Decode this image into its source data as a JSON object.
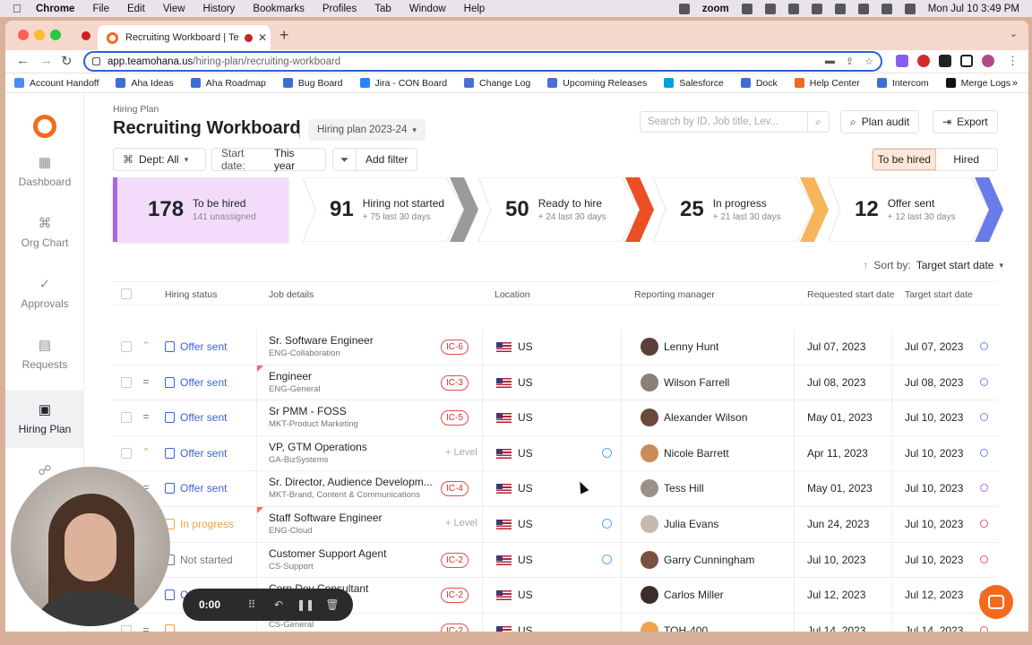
{
  "menubar": {
    "app": "Chrome",
    "items": [
      "File",
      "Edit",
      "View",
      "History",
      "Bookmarks",
      "Profiles",
      "Tab",
      "Window",
      "Help"
    ],
    "zoom": "zoom",
    "datetime": "Mon Jul 10  3:49 PM"
  },
  "browser": {
    "tab_title": "Recruiting Workboard | Te",
    "url_host": "app.teamohana.us",
    "url_path": "/hiring-plan/recruiting-workboard"
  },
  "bookmarks": [
    {
      "label": "Account Handoff",
      "color": "#4a8cf7"
    },
    {
      "label": "Aha Ideas",
      "color": "#3b6fd6"
    },
    {
      "label": "Aha Roadmap",
      "color": "#3b6fd6"
    },
    {
      "label": "Bug Board",
      "color": "#3b6fd6"
    },
    {
      "label": "Jira - CON Board",
      "color": "#2684ff"
    },
    {
      "label": "Change Log",
      "color": "#4a6fd6"
    },
    {
      "label": "Upcoming Releases",
      "color": "#4a6fd6"
    },
    {
      "label": "Salesforce",
      "color": "#00a1e0"
    },
    {
      "label": "Dock",
      "color": "#3b6fd6"
    },
    {
      "label": "Help Center",
      "color": "#f26b1d"
    },
    {
      "label": "Intercom",
      "color": "#3b6fd6"
    },
    {
      "label": "Merge Logs",
      "color": "#111111"
    }
  ],
  "sidebar": {
    "items": [
      {
        "label": "Dashboard",
        "icon": "grid-icon"
      },
      {
        "label": "Org Chart",
        "icon": "org-chart-icon"
      },
      {
        "label": "Approvals",
        "icon": "check-icon"
      },
      {
        "label": "Requests",
        "icon": "document-icon"
      },
      {
        "label": "Hiring Plan",
        "icon": "calendar-icon"
      },
      {
        "label": "He",
        "icon": "people-icon"
      }
    ]
  },
  "header": {
    "breadcrumb": "Hiring Plan",
    "title": "Recruiting Workboard",
    "plan": "Hiring plan 2023-24",
    "search_placeholder": "Search by ID, Job title, Lev...",
    "plan_audit": "Plan audit",
    "export": "Export"
  },
  "filters": {
    "dept": "Dept: All",
    "start_label": "Start date:",
    "start_value": "This year",
    "add_filter": "Add filter",
    "toggle_on": "To be hired",
    "toggle_off": "Hired"
  },
  "summary": [
    {
      "num": "178",
      "label": "To be hired",
      "sub": "141 unassigned",
      "color": "#a869e0"
    },
    {
      "num": "91",
      "label": "Hiring not started",
      "sub": "+ 75 last 30 days",
      "color": "#9a9a9a"
    },
    {
      "num": "50",
      "label": "Ready to hire",
      "sub": "+ 24 last 30 days",
      "color": "#ec4f23"
    },
    {
      "num": "25",
      "label": "In progress",
      "sub": "+ 21 last 30 days",
      "color": "#f7b55a"
    },
    {
      "num": "12",
      "label": "Offer sent",
      "sub": "+ 12 last 30 days",
      "color": "#6a7bea"
    }
  ],
  "sort": {
    "label": "Sort by:",
    "value": "Target start date"
  },
  "table": {
    "headers": [
      "Hiring status",
      "Job details",
      "Location",
      "Reporting manager",
      "Requested start date",
      "Target start date"
    ],
    "rows": [
      {
        "prio": "⌃",
        "status": "Offer sent",
        "status_color": "#3b63d6",
        "title": "Sr. Software Engineer",
        "dept": "ENG-Collaboration",
        "level": "IC-6",
        "loc": "US",
        "globe": false,
        "mgr": "Lenny Hunt",
        "av": "#5a4038",
        "req": "Jul 07, 2023",
        "tgt": "Jul 07, 2023",
        "tcolor": "#6d8ef0",
        "tri": false
      },
      {
        "prio": "=",
        "status": "Offer sent",
        "status_color": "#3b63d6",
        "title": "Engineer",
        "dept": "ENG-General",
        "level": "IC-3",
        "loc": "US",
        "globe": false,
        "mgr": "Wilson Farrell",
        "av": "#8a8076",
        "req": "Jul 08, 2023",
        "tgt": "Jul 08, 2023",
        "tcolor": "#b46cf0",
        "tri": true
      },
      {
        "prio": "=",
        "status": "Offer sent",
        "status_color": "#3b63d6",
        "title": "Sr PMM - FOSS",
        "dept": "MKT-Product Marketing",
        "level": "IC-5",
        "loc": "US",
        "globe": false,
        "mgr": "Alexander Wilson",
        "av": "#6a4a3a",
        "req": "May 01, 2023",
        "tgt": "Jul 10, 2023",
        "tcolor": "#6d8ef0",
        "tri": false
      },
      {
        "prio": "⌃",
        "status": "Offer sent",
        "status_color": "#3b63d6",
        "title": "VP, GTM Operations",
        "dept": "GA-BizSystems",
        "level": "+ Level",
        "loc": "US",
        "globe": true,
        "mgr": "Nicole Barrett",
        "av": "#c98b5a",
        "req": "Apr 11, 2023",
        "tgt": "Jul 10, 2023",
        "tcolor": "#6d8ef0",
        "tri": false
      },
      {
        "prio": "=",
        "status": "Offer sent",
        "status_color": "#3b63d6",
        "title": "Sr. Director, Audience Developm...",
        "dept": "MKT-Brand, Content & Communications",
        "level": "IC-4",
        "loc": "US",
        "globe": false,
        "mgr": "Tess Hill",
        "av": "#9a928a",
        "req": "May 01, 2023",
        "tgt": "Jul 10, 2023",
        "tcolor": "#b46cf0",
        "tri": false
      },
      {
        "prio": "",
        "status": "In progress",
        "status_color": "#f0a14a",
        "title": "Staff Software Engineer",
        "dept": "ENG-Cloud",
        "level": "+ Level",
        "loc": "US",
        "globe": true,
        "mgr": "Julia Evans",
        "av": "#c7b9ae",
        "req": "Jun 24, 2023",
        "tgt": "Jul 10, 2023",
        "tcolor": "#e45a5a",
        "tri": true
      },
      {
        "prio": "",
        "status": "Not started",
        "status_color": "#777777",
        "title": "Customer Support Agent",
        "dept": "CS-Support",
        "level": "IC-2",
        "loc": "US",
        "globe": true,
        "mgr": "Garry Cunningham",
        "av": "#7a5040",
        "req": "Jul 10, 2023",
        "tgt": "Jul 10, 2023",
        "tcolor": "#e45a5a",
        "tri": false
      },
      {
        "prio": "",
        "status": "Offer sent",
        "status_color": "#3b63d6",
        "title": "Corp Dev Consultant",
        "dept": "",
        "level": "IC-2",
        "loc": "US",
        "globe": false,
        "mgr": "Carlos Miller",
        "av": "#3a2e28",
        "req": "Jul 12, 2023",
        "tgt": "Jul 12, 2023",
        "tcolor": "#6d8ef0",
        "tri": false
      },
      {
        "prio": "=",
        "status": "",
        "status_color": "#f0a14a",
        "title": "",
        "dept": "CS-General",
        "level": "IC-2",
        "loc": "US",
        "globe": false,
        "mgr": "TOH-400",
        "av": "#f0a14a",
        "req": "Jul 14, 2023",
        "tgt": "Jul 14, 2023",
        "tcolor": "#e45a5a",
        "tri": false
      }
    ]
  },
  "recorder": {
    "time": "0:00"
  }
}
